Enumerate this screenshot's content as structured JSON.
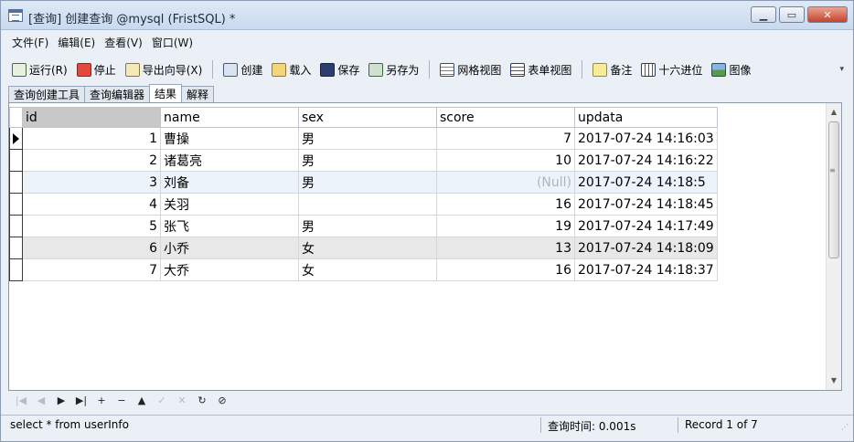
{
  "window": {
    "title": "[查询] 创建查询 @mysql (FristSQL) *",
    "min_label": "▁",
    "max_label": "▭",
    "close_label": "✕"
  },
  "menu": [
    "文件(F)",
    "编辑(E)",
    "查看(V)",
    "窗口(W)"
  ],
  "toolbar": {
    "run": "运行(R)",
    "stop": "停止",
    "export_wizard": "导出向导(X)",
    "create": "创建",
    "load": "载入",
    "save": "保存",
    "save_as": "另存为",
    "grid_view": "网格视图",
    "form_view": "表单视图",
    "note": "备注",
    "hex": "十六进位",
    "image": "图像"
  },
  "tabs": [
    "查询创建工具",
    "查询编辑器",
    "结果",
    "解释"
  ],
  "grid": {
    "columns": [
      "id",
      "name",
      "sex",
      "score",
      "updata"
    ],
    "rows": [
      {
        "id": "1",
        "name": "曹操",
        "sex": "男",
        "score": "7",
        "updata": "2017-07-24 14:16:03"
      },
      {
        "id": "2",
        "name": "诸葛亮",
        "sex": "男",
        "score": "10",
        "updata": "2017-07-24 14:16:22"
      },
      {
        "id": "3",
        "name": "刘备",
        "sex": "男",
        "score": "(Null)",
        "updata": "2017-07-24 14:18:5"
      },
      {
        "id": "4",
        "name": "关羽",
        "sex": "",
        "score": "16",
        "updata": "2017-07-24 14:18:45"
      },
      {
        "id": "5",
        "name": "张飞",
        "sex": "男",
        "score": "19",
        "updata": "2017-07-24 14:17:49"
      },
      {
        "id": "6",
        "name": "小乔",
        "sex": "女",
        "score": "13",
        "updata": "2017-07-24 14:18:09"
      },
      {
        "id": "7",
        "name": "大乔",
        "sex": "女",
        "score": "16",
        "updata": "2017-07-24 14:18:37"
      }
    ]
  },
  "scrollbar": {
    "up": "▲",
    "down": "▼",
    "grip": "≡"
  },
  "nav": [
    "|◀",
    "◀",
    "▶",
    "▶|",
    "+",
    "−",
    "▲",
    "✓",
    "✕",
    "↻",
    "⊘"
  ],
  "status": {
    "sql": "select * from userInfo",
    "query_time": "查询时间: 0.001s",
    "record": "Record 1 of 7"
  },
  "colors": {
    "window_bg": "#ebf0f7",
    "header_selected": "#c8c8c8",
    "row_selected": "#edf3fb",
    "row_alt": "#e8e8e8",
    "null_text": "#b0b5bd"
  }
}
